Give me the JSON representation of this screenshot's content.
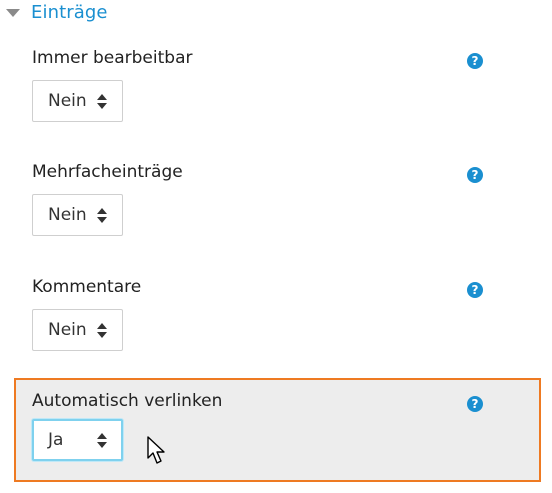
{
  "section": {
    "title": "Einträge",
    "icon": "caret-down-icon"
  },
  "fields": [
    {
      "label": "Immer bearbeitbar",
      "value": "Nein",
      "help_icon": "?"
    },
    {
      "label": "Mehrfacheinträge",
      "value": "Nein",
      "help_icon": "?"
    },
    {
      "label": "Kommentare",
      "value": "Nein",
      "help_icon": "?"
    },
    {
      "label": "Automatisch verlinken",
      "value": "Ja",
      "help_icon": "?"
    }
  ],
  "colors": {
    "accent": "#1a8fd0",
    "highlight_border": "#ee7a22",
    "highlight_bg": "#ededed",
    "focus_border": "#7fd1ee"
  }
}
